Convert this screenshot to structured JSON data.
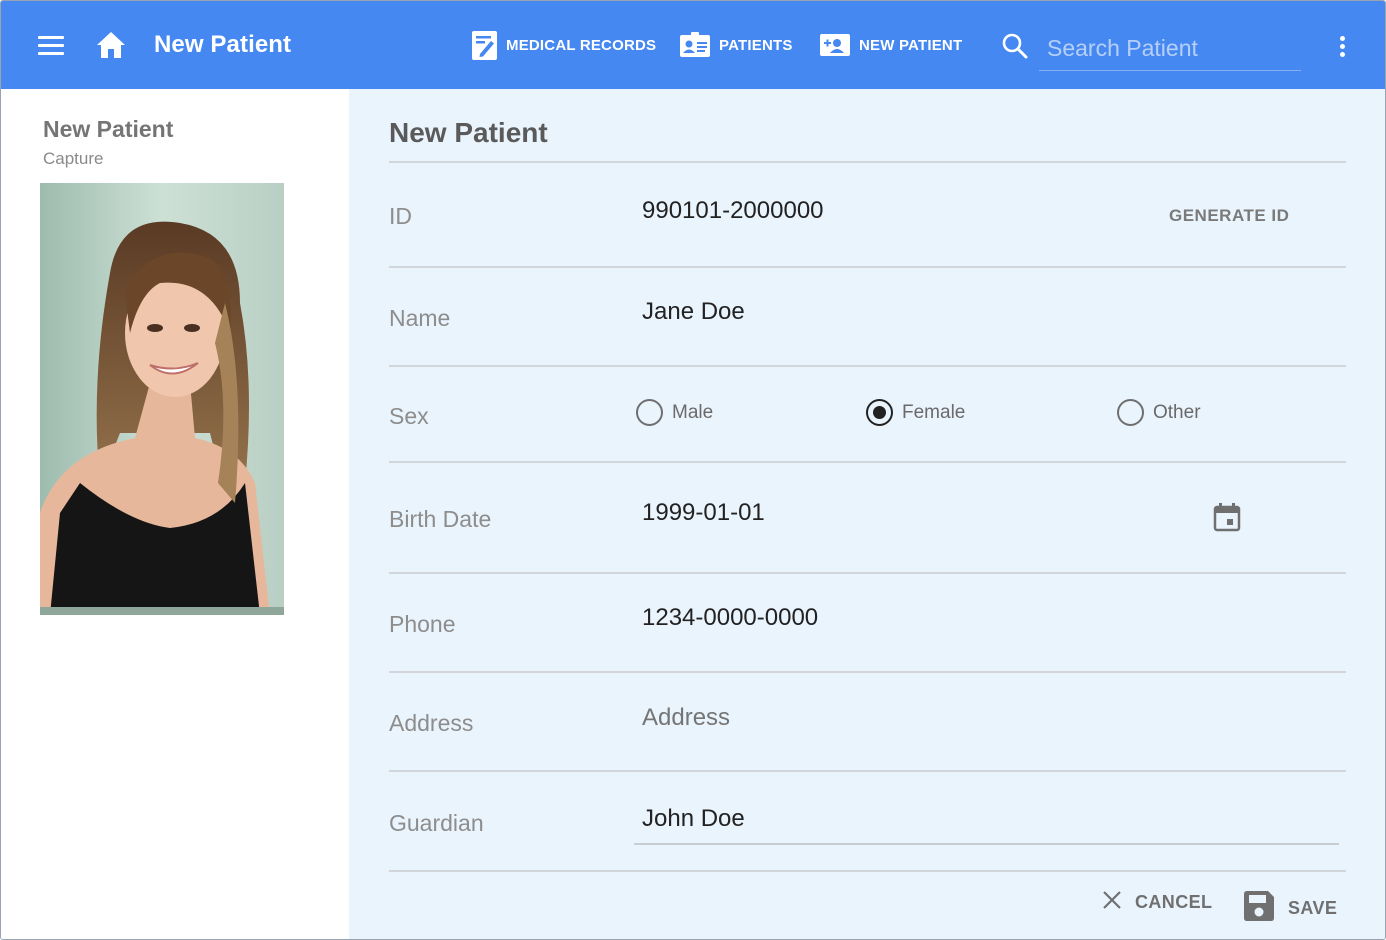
{
  "appbar": {
    "title": "New Patient",
    "nav": [
      {
        "label": "MEDICAL RECORDS",
        "icon": "medical-records-icon"
      },
      {
        "label": "PATIENTS",
        "icon": "patient-card-icon"
      },
      {
        "label": "NEW PATIENT",
        "icon": "add-patient-icon"
      }
    ],
    "search_placeholder": "Search Patient"
  },
  "sidebar": {
    "title": "New Patient",
    "subtitle": "Capture"
  },
  "form": {
    "title": "New Patient",
    "fields": {
      "id": {
        "label": "ID",
        "value": "990101-2000000"
      },
      "name": {
        "label": "Name",
        "value": "Jane Doe"
      },
      "sex": {
        "label": "Sex",
        "options": [
          "Male",
          "Female",
          "Other"
        ],
        "selected": "Female"
      },
      "birth_date": {
        "label": "Birth Date",
        "value": "1999-01-01"
      },
      "phone": {
        "label": "Phone",
        "value": "1234-0000-0000"
      },
      "address": {
        "label": "Address",
        "placeholder": "Address"
      },
      "guardian": {
        "label": "Guardian",
        "value": "John Doe"
      }
    },
    "generate_id_label": "GENERATE ID",
    "cancel_label": "CANCEL",
    "save_label": "SAVE"
  },
  "colors": {
    "appbar": "#4688f1",
    "form_background": "#eaf4fd",
    "divider": "#d2d6da"
  }
}
